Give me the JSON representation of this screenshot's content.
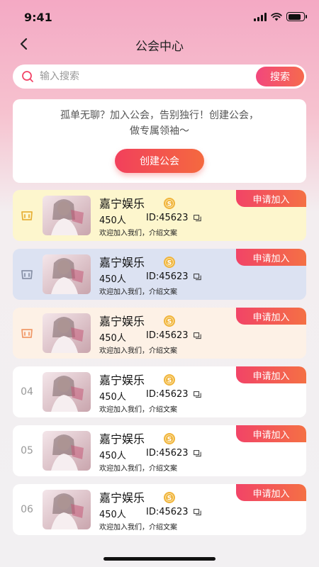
{
  "status_bar": {
    "time": "9:41",
    "battery_level": 0.85
  },
  "header": {
    "title": "公会中心",
    "back_icon": "chevron-left-icon"
  },
  "search": {
    "placeholder": "输入搜索",
    "button_label": "搜索",
    "icon": "search-icon"
  },
  "promo": {
    "text_line1": "孤单无聊？加入公会，告别独行！创建公会，",
    "text_line2": "做专属领袖～",
    "create_button": "创建公会"
  },
  "guilds": [
    {
      "rank": "01",
      "name": "嘉宁娱乐",
      "members": "450人",
      "id": "ID:45623",
      "desc": "欢迎加入我们，介绍文案",
      "apply": "申请加入",
      "bg": "#fdf6cd",
      "rank_color": "#e8b23a"
    },
    {
      "rank": "02",
      "name": "嘉宁娱乐",
      "members": "450人",
      "id": "ID:45623",
      "desc": "欢迎加入我们，介绍文案",
      "apply": "申请加入",
      "bg": "#dce2f2",
      "rank_color": "#8a93a8"
    },
    {
      "rank": "03",
      "name": "嘉宁娱乐",
      "members": "450人",
      "id": "ID:45623",
      "desc": "欢迎加入我们，介绍文案",
      "apply": "申请加入",
      "bg": "#fdf1e6",
      "rank_color": "#f09a6a"
    },
    {
      "rank": "04",
      "name": "嘉宁娱乐",
      "members": "450人",
      "id": "ID:45623",
      "desc": "欢迎加入我们，介绍文案",
      "apply": "申请加入",
      "bg": "#ffffff",
      "rank_color": "#999999"
    },
    {
      "rank": "05",
      "name": "嘉宁娱乐",
      "members": "450人",
      "id": "ID:45623",
      "desc": "欢迎加入我们，介绍文案",
      "apply": "申请加入",
      "bg": "#ffffff",
      "rank_color": "#999999"
    },
    {
      "rank": "06",
      "name": "嘉宁娱乐",
      "members": "450人",
      "id": "ID:45623",
      "desc": "欢迎加入我们，介绍文案",
      "apply": "申请加入",
      "bg": "#ffffff",
      "rank_color": "#999999"
    }
  ],
  "colors": {
    "accent_start": "#f2477d",
    "accent_end": "#f66a4d",
    "coin": "#f0b43c"
  }
}
